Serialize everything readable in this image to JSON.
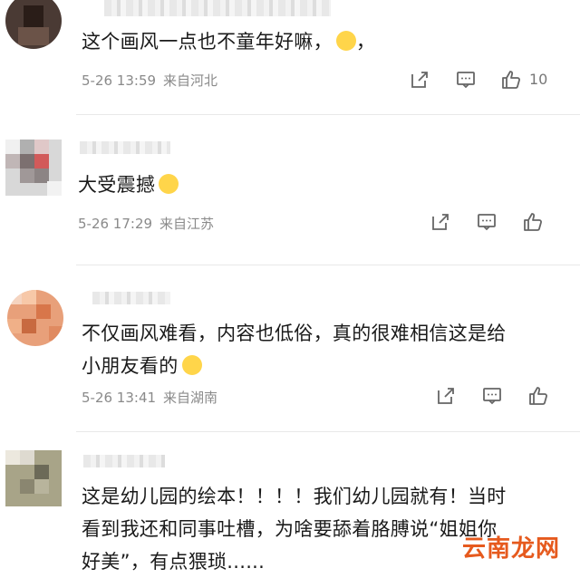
{
  "comments": [
    {
      "text_lines": [
        "这个画风一点也不童年好嘛，",
        "，"
      ],
      "date": "5-26 13:59",
      "location": "来自河北",
      "likes": "10"
    },
    {
      "text_lines": [
        "大受震撼"
      ],
      "date": "5-26 17:29",
      "location": "来自江苏",
      "likes": ""
    },
    {
      "text_lines": [
        "不仅画风难看，内容也低俗，真的很难相信这是给",
        "小朋友看的"
      ],
      "date": "5-26 13:41",
      "location": "来自湖南",
      "likes": ""
    },
    {
      "text_lines": [
        "这是幼儿园的绘本！！！！我们幼儿园就有！当时",
        "看到我还和同事吐槽，为啥要舔着胳膊说“姐姐你",
        "好美”，有点猥琐......"
      ]
    }
  ],
  "icons": [
    "share-icon",
    "comment-icon",
    "like-icon"
  ],
  "watermark": "云南龙网",
  "colors": {
    "meta": "#8a8a8a",
    "text": "#1a1a1a",
    "watermark": "#e65a1e"
  }
}
